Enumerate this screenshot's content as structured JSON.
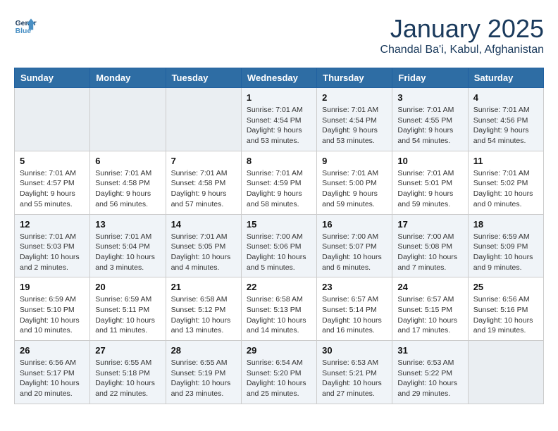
{
  "header": {
    "logo_line1": "General",
    "logo_line2": "Blue",
    "month": "January 2025",
    "location": "Chandal Ba'i, Kabul, Afghanistan"
  },
  "days_of_week": [
    "Sunday",
    "Monday",
    "Tuesday",
    "Wednesday",
    "Thursday",
    "Friday",
    "Saturday"
  ],
  "weeks": [
    [
      {
        "day": "",
        "info": ""
      },
      {
        "day": "",
        "info": ""
      },
      {
        "day": "",
        "info": ""
      },
      {
        "day": "1",
        "info": "Sunrise: 7:01 AM\nSunset: 4:54 PM\nDaylight: 9 hours and 53 minutes."
      },
      {
        "day": "2",
        "info": "Sunrise: 7:01 AM\nSunset: 4:54 PM\nDaylight: 9 hours and 53 minutes."
      },
      {
        "day": "3",
        "info": "Sunrise: 7:01 AM\nSunset: 4:55 PM\nDaylight: 9 hours and 54 minutes."
      },
      {
        "day": "4",
        "info": "Sunrise: 7:01 AM\nSunset: 4:56 PM\nDaylight: 9 hours and 54 minutes."
      }
    ],
    [
      {
        "day": "5",
        "info": "Sunrise: 7:01 AM\nSunset: 4:57 PM\nDaylight: 9 hours and 55 minutes."
      },
      {
        "day": "6",
        "info": "Sunrise: 7:01 AM\nSunset: 4:58 PM\nDaylight: 9 hours and 56 minutes."
      },
      {
        "day": "7",
        "info": "Sunrise: 7:01 AM\nSunset: 4:58 PM\nDaylight: 9 hours and 57 minutes."
      },
      {
        "day": "8",
        "info": "Sunrise: 7:01 AM\nSunset: 4:59 PM\nDaylight: 9 hours and 58 minutes."
      },
      {
        "day": "9",
        "info": "Sunrise: 7:01 AM\nSunset: 5:00 PM\nDaylight: 9 hours and 59 minutes."
      },
      {
        "day": "10",
        "info": "Sunrise: 7:01 AM\nSunset: 5:01 PM\nDaylight: 9 hours and 59 minutes."
      },
      {
        "day": "11",
        "info": "Sunrise: 7:01 AM\nSunset: 5:02 PM\nDaylight: 10 hours and 0 minutes."
      }
    ],
    [
      {
        "day": "12",
        "info": "Sunrise: 7:01 AM\nSunset: 5:03 PM\nDaylight: 10 hours and 2 minutes."
      },
      {
        "day": "13",
        "info": "Sunrise: 7:01 AM\nSunset: 5:04 PM\nDaylight: 10 hours and 3 minutes."
      },
      {
        "day": "14",
        "info": "Sunrise: 7:01 AM\nSunset: 5:05 PM\nDaylight: 10 hours and 4 minutes."
      },
      {
        "day": "15",
        "info": "Sunrise: 7:00 AM\nSunset: 5:06 PM\nDaylight: 10 hours and 5 minutes."
      },
      {
        "day": "16",
        "info": "Sunrise: 7:00 AM\nSunset: 5:07 PM\nDaylight: 10 hours and 6 minutes."
      },
      {
        "day": "17",
        "info": "Sunrise: 7:00 AM\nSunset: 5:08 PM\nDaylight: 10 hours and 7 minutes."
      },
      {
        "day": "18",
        "info": "Sunrise: 6:59 AM\nSunset: 5:09 PM\nDaylight: 10 hours and 9 minutes."
      }
    ],
    [
      {
        "day": "19",
        "info": "Sunrise: 6:59 AM\nSunset: 5:10 PM\nDaylight: 10 hours and 10 minutes."
      },
      {
        "day": "20",
        "info": "Sunrise: 6:59 AM\nSunset: 5:11 PM\nDaylight: 10 hours and 11 minutes."
      },
      {
        "day": "21",
        "info": "Sunrise: 6:58 AM\nSunset: 5:12 PM\nDaylight: 10 hours and 13 minutes."
      },
      {
        "day": "22",
        "info": "Sunrise: 6:58 AM\nSunset: 5:13 PM\nDaylight: 10 hours and 14 minutes."
      },
      {
        "day": "23",
        "info": "Sunrise: 6:57 AM\nSunset: 5:14 PM\nDaylight: 10 hours and 16 minutes."
      },
      {
        "day": "24",
        "info": "Sunrise: 6:57 AM\nSunset: 5:15 PM\nDaylight: 10 hours and 17 minutes."
      },
      {
        "day": "25",
        "info": "Sunrise: 6:56 AM\nSunset: 5:16 PM\nDaylight: 10 hours and 19 minutes."
      }
    ],
    [
      {
        "day": "26",
        "info": "Sunrise: 6:56 AM\nSunset: 5:17 PM\nDaylight: 10 hours and 20 minutes."
      },
      {
        "day": "27",
        "info": "Sunrise: 6:55 AM\nSunset: 5:18 PM\nDaylight: 10 hours and 22 minutes."
      },
      {
        "day": "28",
        "info": "Sunrise: 6:55 AM\nSunset: 5:19 PM\nDaylight: 10 hours and 23 minutes."
      },
      {
        "day": "29",
        "info": "Sunrise: 6:54 AM\nSunset: 5:20 PM\nDaylight: 10 hours and 25 minutes."
      },
      {
        "day": "30",
        "info": "Sunrise: 6:53 AM\nSunset: 5:21 PM\nDaylight: 10 hours and 27 minutes."
      },
      {
        "day": "31",
        "info": "Sunrise: 6:53 AM\nSunset: 5:22 PM\nDaylight: 10 hours and 29 minutes."
      },
      {
        "day": "",
        "info": ""
      }
    ]
  ]
}
